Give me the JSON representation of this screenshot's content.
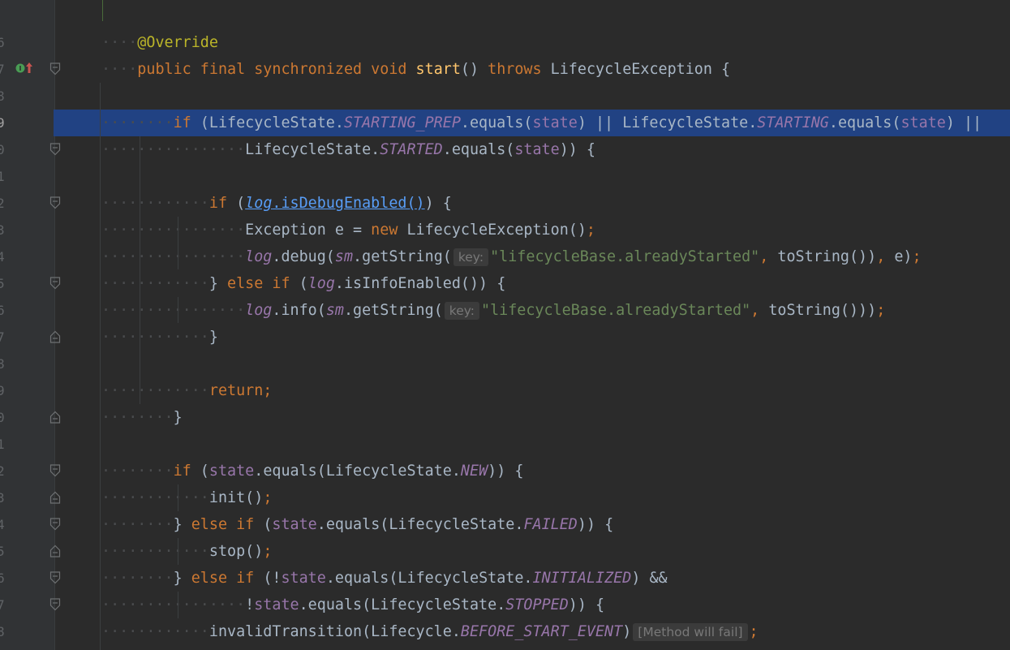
{
  "editor": {
    "colors": {
      "background": "#2b2b2b",
      "gutter": "#313335",
      "selection": "#214283",
      "keyword": "#cc7832",
      "annotation": "#bbb529",
      "method": "#ffc66d",
      "field": "#9876aa",
      "string": "#6a8759",
      "text": "#a9b7c6"
    },
    "line_numbers": [
      "6",
      "7",
      "8",
      "9",
      "0",
      "1",
      "2",
      "3",
      "4",
      "5",
      "6",
      "7",
      "8",
      "9",
      "0",
      "1",
      "2",
      "3",
      "4",
      "5",
      "6",
      "7",
      "8"
    ],
    "gutter_icon": "overriding-method-icon",
    "lines": [
      {
        "tokens": [
          {
            "t": "ws",
            "v": "····"
          },
          {
            "t": "ann",
            "v": "@Override"
          }
        ]
      },
      {
        "tokens": [
          {
            "t": "ws",
            "v": "····"
          },
          {
            "t": "kw",
            "v": "public final synchronized void "
          },
          {
            "t": "fn",
            "v": "start"
          },
          {
            "t": "txt",
            "v": "() "
          },
          {
            "t": "kw",
            "v": "throws "
          },
          {
            "t": "txt",
            "v": "LifecycleException {"
          }
        ]
      },
      {
        "tokens": []
      },
      {
        "tokens": [
          {
            "t": "ws",
            "v": "········"
          },
          {
            "t": "kw",
            "v": "if "
          },
          {
            "t": "txt",
            "v": "(LifecycleState."
          },
          {
            "t": "cst",
            "v": "STARTING_PREP"
          },
          {
            "t": "txt",
            "v": ".equals("
          },
          {
            "t": "fld",
            "v": "state"
          },
          {
            "t": "txt",
            "v": ") || LifecycleState."
          },
          {
            "t": "cst",
            "v": "STARTING"
          },
          {
            "t": "txt",
            "v": ".equals("
          },
          {
            "t": "fld",
            "v": "state"
          },
          {
            "t": "txt",
            "v": ") ||"
          }
        ]
      },
      {
        "tokens": [
          {
            "t": "ws",
            "v": "················"
          },
          {
            "t": "txt",
            "v": "LifecycleState."
          },
          {
            "t": "cst",
            "v": "STARTED"
          },
          {
            "t": "txt",
            "v": ".equals("
          },
          {
            "t": "fld",
            "v": "state"
          },
          {
            "t": "txt",
            "v": ")) {"
          }
        ]
      },
      {
        "tokens": []
      },
      {
        "tokens": [
          {
            "t": "ws",
            "v": "············"
          },
          {
            "t": "kw",
            "v": "if "
          },
          {
            "t": "txt",
            "v": "("
          },
          {
            "t": "link",
            "v": "log"
          },
          {
            "t": "linkf",
            "v": ".isDebugEnabled()"
          },
          {
            "t": "txt",
            "v": ") {"
          }
        ]
      },
      {
        "tokens": [
          {
            "t": "ws",
            "v": "················"
          },
          {
            "t": "txt",
            "v": "Exception e = "
          },
          {
            "t": "kw",
            "v": "new "
          },
          {
            "t": "txt",
            "v": "LifecycleException()"
          },
          {
            "t": "kw",
            "v": ";"
          }
        ]
      },
      {
        "tokens": [
          {
            "t": "ws",
            "v": "················"
          },
          {
            "t": "sfld",
            "v": "log"
          },
          {
            "t": "txt",
            "v": ".debug("
          },
          {
            "t": "sfld",
            "v": "sm"
          },
          {
            "t": "txt",
            "v": ".getString("
          },
          {
            "t": "hint",
            "v": "key:"
          },
          {
            "t": "str",
            "v": "\"lifecycleBase.alreadyStarted\""
          },
          {
            "t": "kw",
            "v": ", "
          },
          {
            "t": "txt",
            "v": "toString())"
          },
          {
            "t": "kw",
            "v": ", "
          },
          {
            "t": "txt",
            "v": "e)"
          },
          {
            "t": "kw",
            "v": ";"
          }
        ]
      },
      {
        "tokens": [
          {
            "t": "ws",
            "v": "············"
          },
          {
            "t": "txt",
            "v": "} "
          },
          {
            "t": "kw",
            "v": "else if "
          },
          {
            "t": "txt",
            "v": "("
          },
          {
            "t": "sfld",
            "v": "log"
          },
          {
            "t": "txt",
            "v": ".isInfoEnabled()) {"
          }
        ]
      },
      {
        "tokens": [
          {
            "t": "ws",
            "v": "················"
          },
          {
            "t": "sfld",
            "v": "log"
          },
          {
            "t": "txt",
            "v": ".info("
          },
          {
            "t": "sfld",
            "v": "sm"
          },
          {
            "t": "txt",
            "v": ".getString("
          },
          {
            "t": "hint",
            "v": "key:"
          },
          {
            "t": "str",
            "v": "\"lifecycleBase.alreadyStarted\""
          },
          {
            "t": "kw",
            "v": ", "
          },
          {
            "t": "txt",
            "v": "toString()))"
          },
          {
            "t": "kw",
            "v": ";"
          }
        ]
      },
      {
        "tokens": [
          {
            "t": "ws",
            "v": "············"
          },
          {
            "t": "txt",
            "v": "}"
          }
        ]
      },
      {
        "tokens": []
      },
      {
        "tokens": [
          {
            "t": "ws",
            "v": "············"
          },
          {
            "t": "kw",
            "v": "return;"
          }
        ]
      },
      {
        "tokens": [
          {
            "t": "ws",
            "v": "········"
          },
          {
            "t": "txt",
            "v": "}"
          }
        ]
      },
      {
        "tokens": []
      },
      {
        "tokens": [
          {
            "t": "ws",
            "v": "········"
          },
          {
            "t": "kw",
            "v": "if "
          },
          {
            "t": "txt",
            "v": "("
          },
          {
            "t": "fld",
            "v": "state"
          },
          {
            "t": "txt",
            "v": ".equals(LifecycleState."
          },
          {
            "t": "cst",
            "v": "NEW"
          },
          {
            "t": "txt",
            "v": ")) {"
          }
        ]
      },
      {
        "tokens": [
          {
            "t": "ws",
            "v": "············"
          },
          {
            "t": "txt",
            "v": "init()"
          },
          {
            "t": "kw",
            "v": ";"
          }
        ]
      },
      {
        "tokens": [
          {
            "t": "ws",
            "v": "········"
          },
          {
            "t": "txt",
            "v": "} "
          },
          {
            "t": "kw",
            "v": "else if "
          },
          {
            "t": "txt",
            "v": "("
          },
          {
            "t": "fld",
            "v": "state"
          },
          {
            "t": "txt",
            "v": ".equals(LifecycleState."
          },
          {
            "t": "cst",
            "v": "FAILED"
          },
          {
            "t": "txt",
            "v": ")) {"
          }
        ]
      },
      {
        "tokens": [
          {
            "t": "ws",
            "v": "············"
          },
          {
            "t": "txt",
            "v": "stop()"
          },
          {
            "t": "kw",
            "v": ";"
          }
        ]
      },
      {
        "tokens": [
          {
            "t": "ws",
            "v": "········"
          },
          {
            "t": "txt",
            "v": "} "
          },
          {
            "t": "kw",
            "v": "else if "
          },
          {
            "t": "txt",
            "v": "(!"
          },
          {
            "t": "fld",
            "v": "state"
          },
          {
            "t": "txt",
            "v": ".equals(LifecycleState."
          },
          {
            "t": "cst",
            "v": "INITIALIZED"
          },
          {
            "t": "txt",
            "v": ") &&"
          }
        ]
      },
      {
        "tokens": [
          {
            "t": "ws",
            "v": "················"
          },
          {
            "t": "txt",
            "v": "!"
          },
          {
            "t": "fld",
            "v": "state"
          },
          {
            "t": "txt",
            "v": ".equals(LifecycleState."
          },
          {
            "t": "cst",
            "v": "STOPPED"
          },
          {
            "t": "txt",
            "v": ")) {"
          }
        ]
      },
      {
        "tokens": [
          {
            "t": "ws",
            "v": "············"
          },
          {
            "t": "txt",
            "v": "invalidTransition(Lifecycle."
          },
          {
            "t": "cst",
            "v": "BEFORE_START_EVENT"
          },
          {
            "t": "txt",
            "v": ")"
          },
          {
            "t": "hint",
            "v": "[Method will fail]"
          },
          {
            "t": "kw",
            "v": ";"
          }
        ]
      }
    ]
  }
}
